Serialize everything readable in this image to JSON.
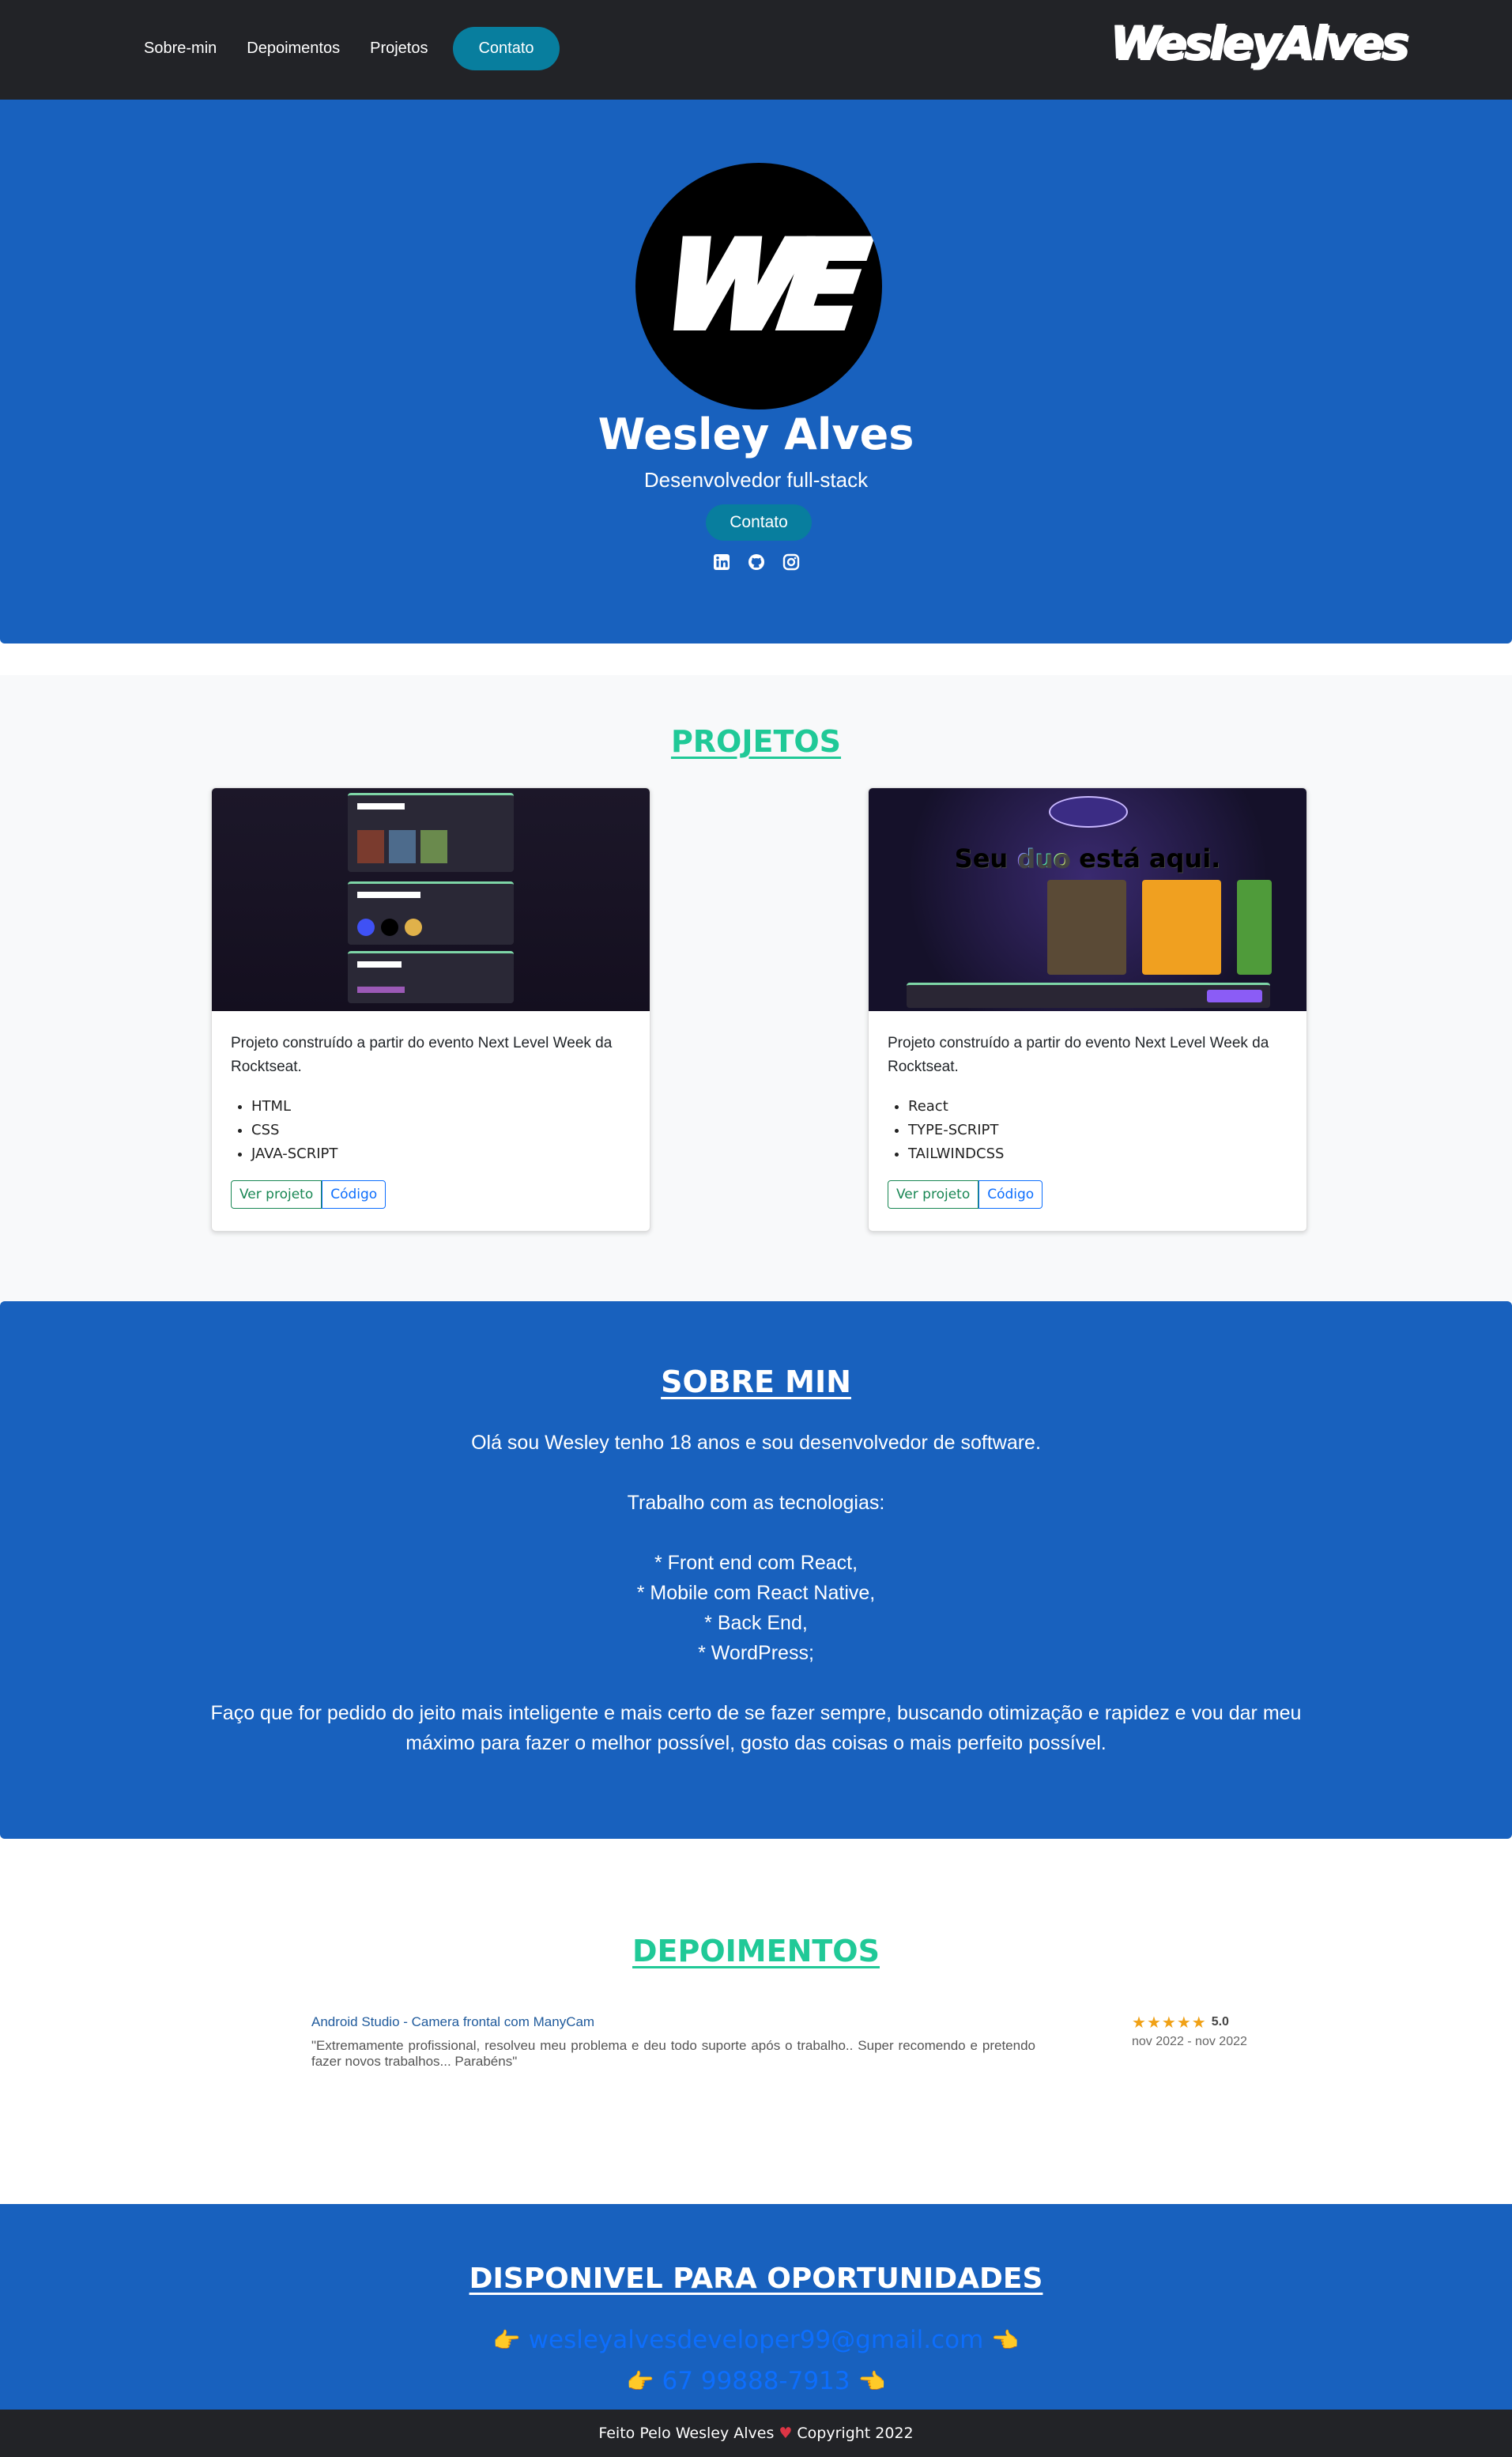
{
  "nav": {
    "links": [
      "Sobre-min",
      "Depoimentos",
      "Projetos"
    ],
    "contact_label": "Contato",
    "brand": "WesleyAlves"
  },
  "hero": {
    "avatar_text": "WE",
    "name": "Wesley Alves",
    "role": "Desenvolvedor full-stack",
    "contact_label": "Contato",
    "social_icons": [
      "linkedin-icon",
      "github-icon",
      "instagram-icon"
    ]
  },
  "projects": {
    "title": "PROJETOS",
    "cards": [
      {
        "text": "Projeto construído a partir do evento Next Level Week da Rocktseat.",
        "tech": [
          "HTML",
          "CSS",
          "JAVA-SCRIPT"
        ],
        "view_label": "Ver projeto",
        "code_label": "Código"
      },
      {
        "text": "Projeto construído a partir do evento Next Level Week da Rocktseat.",
        "tech": [
          "React",
          "TYPE-SCRIPT",
          "TAILWINDCSS"
        ],
        "view_label": "Ver projeto",
        "code_label": "Código",
        "preview_headline": "Seu duo está aqui."
      }
    ]
  },
  "about": {
    "title": "SOBRE MIN",
    "intro": "Olá sou Wesley tenho 18 anos e sou desenvolvedor de software.",
    "tech_heading": "Trabalho com as tecnologias:",
    "tech": [
      "* Front end com React,",
      "* Mobile com React Native,",
      "* Back End,",
      "* WordPress;"
    ],
    "closing": "Faço que for pedido do jeito mais inteligente e mais certo de se fazer sempre, buscando otimização e rapidez e vou dar meu máximo para fazer o melhor possível, gosto das coisas o mais perfeito possível."
  },
  "testimonials": {
    "title": "DEPOIMENTOS",
    "items": [
      {
        "title": "Android Studio - Camera frontal com ManyCam",
        "text": "\"Extremamente profissional, resolveu meu problema e deu todo suporte após o trabalho.. Super recomendo e pretendo fazer novos trabalhos... Parabéns\"",
        "rating": "5.0",
        "date": "nov 2022 - nov 2022"
      }
    ]
  },
  "contact": {
    "title": "DISPONIVEL PARA OPORTUNIDADES",
    "email": "wesleyalvesdeveloper99@gmail.com",
    "phone": "67 99888-7913"
  },
  "footer": {
    "left": "Feito Pelo Wesley Alves",
    "right": "Copyright 2022"
  },
  "colors": {
    "navbar": "#222327",
    "primary_blue": "#1861be",
    "accent_teal": "#087e9e",
    "section_title_green": "#20c997"
  }
}
